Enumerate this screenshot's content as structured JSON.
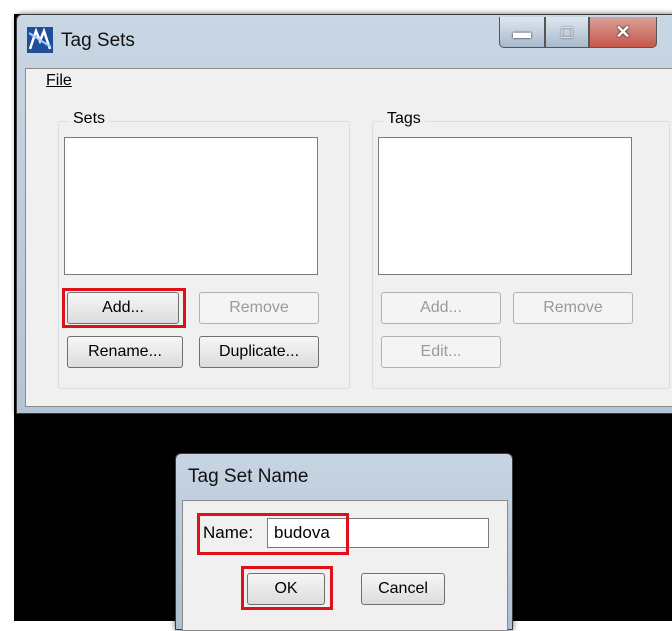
{
  "main_window": {
    "title": "Tag Sets",
    "menu": {
      "file": "File"
    },
    "sets_group": {
      "label": "Sets",
      "add": "Add...",
      "remove": "Remove",
      "rename": "Rename...",
      "duplicate": "Duplicate..."
    },
    "tags_group": {
      "label": "Tags",
      "add": "Add...",
      "remove": "Remove",
      "edit": "Edit..."
    }
  },
  "dialog": {
    "title": "Tag Set Name",
    "name_label": "Name:",
    "name_value": "budova",
    "ok": "OK",
    "cancel": "Cancel"
  },
  "colors": {
    "highlight": "#e0101a"
  }
}
